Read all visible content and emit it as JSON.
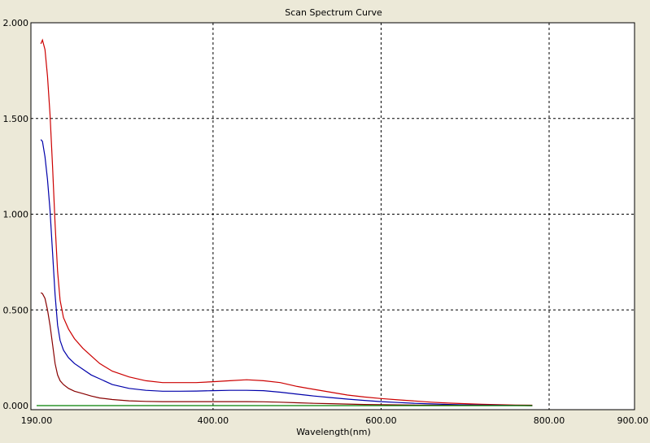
{
  "chart_data": {
    "type": "line",
    "title": "Scan Spectrum Curve",
    "xlabel": "Wavelength(nm)",
    "ylabel": "",
    "xlim": [
      190,
      900
    ],
    "ylim": [
      0,
      2
    ],
    "x_ticks": [
      {
        "value": 190,
        "label": "190.00"
      },
      {
        "value": 400,
        "label": "400.00"
      },
      {
        "value": 600,
        "label": "600.00"
      },
      {
        "value": 800,
        "label": "800.00"
      },
      {
        "value": 900,
        "label": "900.00"
      }
    ],
    "y_ticks": [
      {
        "value": 0,
        "label": "0.000"
      },
      {
        "value": 0.5,
        "label": "0.500"
      },
      {
        "value": 1.0,
        "label": "1.000"
      },
      {
        "value": 1.5,
        "label": "1.500"
      },
      {
        "value": 2.0,
        "label": "2.000"
      }
    ],
    "grid_x": [
      400,
      600,
      800
    ],
    "grid_y": [
      0.5,
      1.0,
      1.5
    ],
    "grid": true,
    "series": [
      {
        "color": "#cc0000",
        "points": [
          [
            195,
            1.89
          ],
          [
            197,
            1.91
          ],
          [
            200,
            1.86
          ],
          [
            203,
            1.72
          ],
          [
            206,
            1.52
          ],
          [
            209,
            1.25
          ],
          [
            212,
            0.95
          ],
          [
            215,
            0.7
          ],
          [
            218,
            0.55
          ],
          [
            222,
            0.46
          ],
          [
            228,
            0.4
          ],
          [
            235,
            0.35
          ],
          [
            245,
            0.3
          ],
          [
            255,
            0.26
          ],
          [
            265,
            0.22
          ],
          [
            280,
            0.18
          ],
          [
            300,
            0.15
          ],
          [
            320,
            0.13
          ],
          [
            340,
            0.12
          ],
          [
            360,
            0.12
          ],
          [
            380,
            0.12
          ],
          [
            400,
            0.125
          ],
          [
            420,
            0.13
          ],
          [
            440,
            0.135
          ],
          [
            460,
            0.13
          ],
          [
            480,
            0.12
          ],
          [
            500,
            0.1
          ],
          [
            520,
            0.085
          ],
          [
            540,
            0.07
          ],
          [
            560,
            0.055
          ],
          [
            580,
            0.045
          ],
          [
            600,
            0.037
          ],
          [
            620,
            0.03
          ],
          [
            640,
            0.024
          ],
          [
            660,
            0.018
          ],
          [
            680,
            0.013
          ],
          [
            700,
            0.01
          ],
          [
            720,
            0.007
          ],
          [
            740,
            0.005
          ],
          [
            760,
            0.003
          ],
          [
            780,
            0.002
          ]
        ]
      },
      {
        "color": "#0000aa",
        "points": [
          [
            195,
            1.39
          ],
          [
            197,
            1.38
          ],
          [
            200,
            1.3
          ],
          [
            203,
            1.18
          ],
          [
            206,
            1.02
          ],
          [
            209,
            0.8
          ],
          [
            212,
            0.58
          ],
          [
            215,
            0.42
          ],
          [
            218,
            0.34
          ],
          [
            222,
            0.29
          ],
          [
            228,
            0.25
          ],
          [
            235,
            0.22
          ],
          [
            245,
            0.19
          ],
          [
            255,
            0.16
          ],
          [
            265,
            0.14
          ],
          [
            280,
            0.11
          ],
          [
            300,
            0.09
          ],
          [
            320,
            0.08
          ],
          [
            340,
            0.075
          ],
          [
            360,
            0.075
          ],
          [
            380,
            0.076
          ],
          [
            400,
            0.078
          ],
          [
            420,
            0.08
          ],
          [
            440,
            0.08
          ],
          [
            460,
            0.078
          ],
          [
            480,
            0.07
          ],
          [
            500,
            0.06
          ],
          [
            520,
            0.05
          ],
          [
            540,
            0.042
          ],
          [
            560,
            0.034
          ],
          [
            580,
            0.027
          ],
          [
            600,
            0.021
          ],
          [
            620,
            0.016
          ],
          [
            640,
            0.012
          ],
          [
            660,
            0.009
          ],
          [
            680,
            0.006
          ],
          [
            700,
            0.004
          ],
          [
            720,
            0.003
          ],
          [
            740,
            0.002
          ],
          [
            760,
            0.001
          ],
          [
            780,
            0.0
          ]
        ]
      },
      {
        "color": "#880000",
        "points": [
          [
            195,
            0.59
          ],
          [
            197,
            0.585
          ],
          [
            200,
            0.56
          ],
          [
            203,
            0.5
          ],
          [
            206,
            0.42
          ],
          [
            209,
            0.32
          ],
          [
            212,
            0.22
          ],
          [
            215,
            0.16
          ],
          [
            218,
            0.13
          ],
          [
            222,
            0.11
          ],
          [
            228,
            0.09
          ],
          [
            235,
            0.075
          ],
          [
            245,
            0.063
          ],
          [
            255,
            0.05
          ],
          [
            265,
            0.04
          ],
          [
            280,
            0.032
          ],
          [
            300,
            0.025
          ],
          [
            320,
            0.022
          ],
          [
            340,
            0.021
          ],
          [
            360,
            0.021
          ],
          [
            380,
            0.021
          ],
          [
            400,
            0.021
          ],
          [
            420,
            0.021
          ],
          [
            440,
            0.021
          ],
          [
            460,
            0.02
          ],
          [
            480,
            0.018
          ],
          [
            500,
            0.015
          ],
          [
            520,
            0.012
          ],
          [
            540,
            0.01
          ],
          [
            560,
            0.008
          ],
          [
            580,
            0.006
          ],
          [
            600,
            0.005
          ],
          [
            620,
            0.004
          ],
          [
            640,
            0.003
          ],
          [
            660,
            0.002
          ],
          [
            680,
            0.0015
          ],
          [
            700,
            0.001
          ],
          [
            720,
            0.0008
          ],
          [
            740,
            0.0005
          ],
          [
            760,
            0.0003
          ],
          [
            780,
            0.0
          ]
        ]
      },
      {
        "color": "#008000",
        "points": [
          [
            190,
            0.0
          ],
          [
            780,
            0.0
          ]
        ]
      }
    ]
  }
}
